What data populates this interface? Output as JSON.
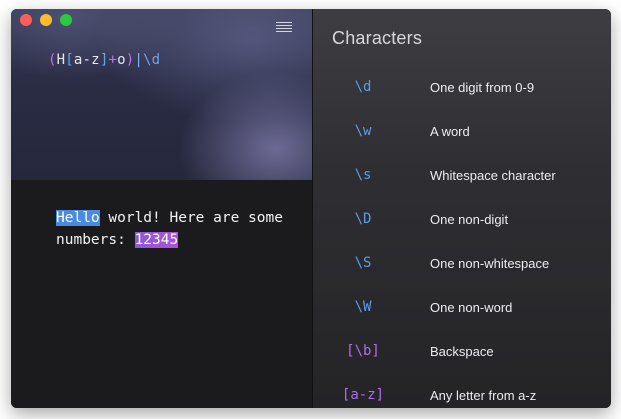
{
  "pattern": {
    "tokens": [
      {
        "text": "(",
        "kind": "paren"
      },
      {
        "text": "H",
        "kind": "plain"
      },
      {
        "text": "[",
        "kind": "bracket"
      },
      {
        "text": "a-z",
        "kind": "plain"
      },
      {
        "text": "]",
        "kind": "bracket"
      },
      {
        "text": "+",
        "kind": "quant"
      },
      {
        "text": "o",
        "kind": "plain"
      },
      {
        "text": ")",
        "kind": "paren"
      },
      {
        "text": "|",
        "kind": "alt"
      },
      {
        "text": "\\d",
        "kind": "escape"
      }
    ]
  },
  "test_text": {
    "match1": "Hello",
    "part1": " world! Here are some numbers: ",
    "match2": "12345"
  },
  "panel": {
    "title": "Characters",
    "items": [
      {
        "token": "\\d",
        "desc": "One digit from 0-9",
        "color": "#5b9ce6"
      },
      {
        "token": "\\w",
        "desc": "A word",
        "color": "#5b9ce6"
      },
      {
        "token": "\\s",
        "desc": "Whitespace character",
        "color": "#5b9ce6"
      },
      {
        "token": "\\D",
        "desc": "One non-digit",
        "color": "#5b9ce6"
      },
      {
        "token": "\\S",
        "desc": "One non-whitespace",
        "color": "#5b9ce6"
      },
      {
        "token": "\\W",
        "desc": "One non-word",
        "color": "#5b9ce6"
      },
      {
        "token": "[\\b]",
        "desc": "Backspace",
        "color": "#b06de8"
      },
      {
        "token": "[a-z]",
        "desc": "Any letter from a-z",
        "color": "#b06de8"
      }
    ]
  }
}
